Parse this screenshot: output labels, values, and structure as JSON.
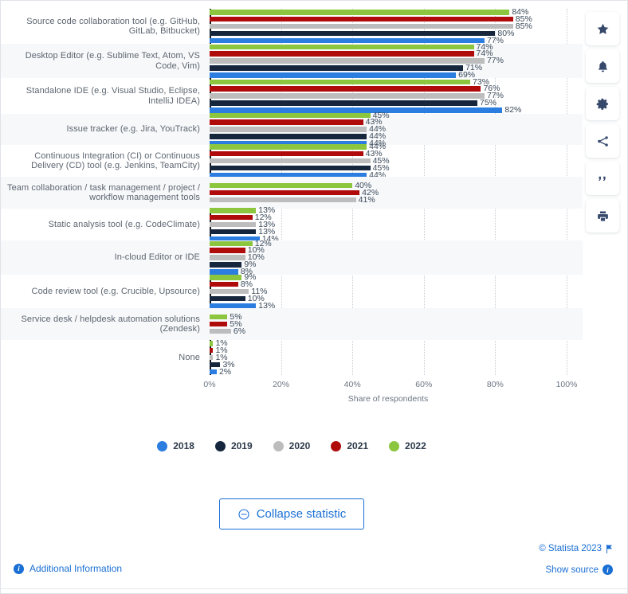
{
  "chart_data": {
    "type": "bar",
    "orientation": "horizontal",
    "title": "",
    "xlabel": "Share of respondents",
    "ylabel": "",
    "xlim": [
      0,
      100
    ],
    "xticks": [
      "0%",
      "20%",
      "40%",
      "60%",
      "80%",
      "100%"
    ],
    "xtick_values": [
      0,
      20,
      40,
      60,
      80,
      100
    ],
    "grid": true,
    "legend_position": "bottom",
    "value_suffix": "%",
    "categories": [
      "Source code collaboration tool (e.g. GitHub, GitLab, Bitbucket)",
      "Desktop Editor (e.g. Sublime Text, Atom, VS Code, Vim)",
      "Standalone IDE (e.g. Visual Studio, Eclipse, IntelliJ IDEA)",
      "Issue tracker (e.g. Jira, YouTrack)",
      "Continuous Integration (CI) or Continuous Delivery (CD) tool (e.g. Jenkins, TeamCity)",
      "Team collaboration / task management / project / workflow management tools",
      "Static analysis tool (e.g. CodeClimate)",
      "In-cloud Editor or IDE",
      "Code review tool (e.g. Crucible, Upsource)",
      "Service desk / helpdesk automation solutions (Zendesk)",
      "None"
    ],
    "series": [
      {
        "name": "2022",
        "color": "#8CC63E",
        "values": [
          84,
          74,
          73,
          45,
          44,
          40,
          13,
          12,
          9,
          5,
          1
        ]
      },
      {
        "name": "2021",
        "color": "#AF0B0B",
        "values": [
          85,
          74,
          76,
          43,
          43,
          42,
          12,
          10,
          8,
          5,
          1
        ]
      },
      {
        "name": "2020",
        "color": "#BDBDBD",
        "values": [
          85,
          77,
          77,
          44,
          45,
          41,
          13,
          10,
          11,
          6,
          1
        ]
      },
      {
        "name": "2019",
        "color": "#15263D",
        "values": [
          80,
          71,
          75,
          44,
          45,
          null,
          13,
          9,
          10,
          null,
          3
        ]
      },
      {
        "name": "2018",
        "color": "#2B7DE0",
        "values": [
          77,
          69,
          82,
          44,
          44,
          null,
          14,
          8,
          13,
          null,
          2
        ]
      }
    ],
    "legend": [
      {
        "label": "2018",
        "color": "#2B7DE0"
      },
      {
        "label": "2019",
        "color": "#15263D"
      },
      {
        "label": "2020",
        "color": "#BDBDBD"
      },
      {
        "label": "2021",
        "color": "#AF0B0B"
      },
      {
        "label": "2022",
        "color": "#8CC63E"
      }
    ]
  },
  "right_rail": [
    {
      "name": "favorite-icon",
      "label": "star"
    },
    {
      "name": "notification-icon",
      "label": "bell"
    },
    {
      "name": "settings-icon",
      "label": "gear"
    },
    {
      "name": "share-icon",
      "label": "share"
    },
    {
      "name": "citation-icon",
      "label": "quote"
    },
    {
      "name": "print-icon",
      "label": "print"
    }
  ],
  "collapse_button": {
    "label": "Collapse statistic",
    "icon": "minus-circle-icon"
  },
  "footer": {
    "copyright": "© Statista 2023",
    "show_source": "Show source",
    "additional_information": "Additional Information"
  },
  "colors": {
    "accent": "#1a6fd4",
    "axis": "#1a1a1a",
    "row_alt": "#f7f8fa",
    "label_text": "#5c6570"
  }
}
